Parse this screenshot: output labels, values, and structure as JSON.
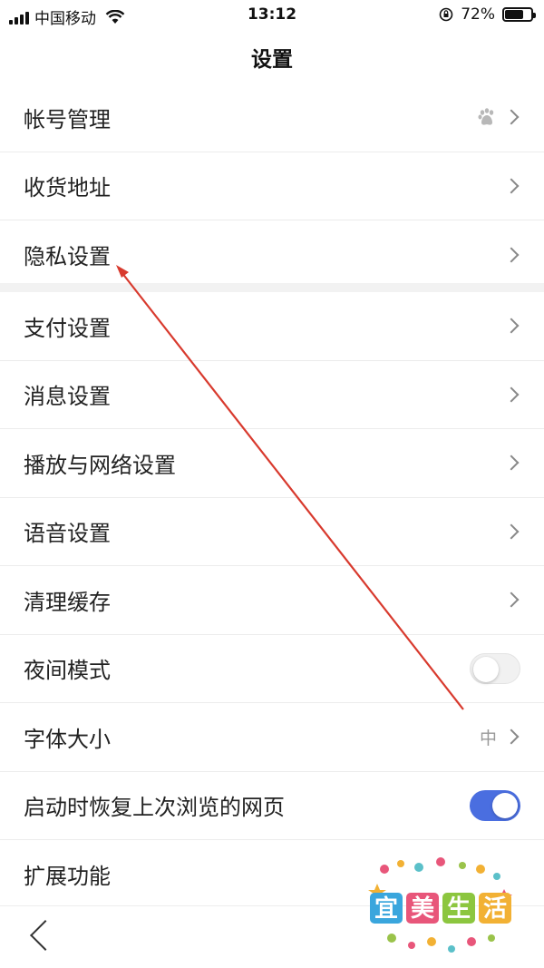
{
  "status_bar": {
    "carrier": "中国移动",
    "time": "13:12",
    "battery_percent": "72%",
    "battery_level": 0.72
  },
  "header": {
    "title": "设置"
  },
  "sections": [
    {
      "items": [
        {
          "label": "帐号管理",
          "accessory": "chevron",
          "icon": "baidu-paw-icon"
        },
        {
          "label": "收货地址",
          "accessory": "chevron"
        },
        {
          "label": "隐私设置",
          "accessory": "chevron"
        }
      ]
    },
    {
      "items": [
        {
          "label": "支付设置",
          "accessory": "chevron"
        },
        {
          "label": "消息设置",
          "accessory": "chevron"
        },
        {
          "label": "播放与网络设置",
          "accessory": "chevron"
        },
        {
          "label": "语音设置",
          "accessory": "chevron"
        },
        {
          "label": "清理缓存",
          "accessory": "chevron"
        },
        {
          "label": "夜间模式",
          "accessory": "toggle",
          "toggle_on": false
        },
        {
          "label": "字体大小",
          "accessory": "chevron",
          "value": "中"
        },
        {
          "label": "启动时恢复上次浏览的网页",
          "accessory": "toggle",
          "toggle_on": true
        },
        {
          "label": "扩展功能",
          "accessory": "none"
        }
      ]
    }
  ],
  "colors": {
    "toggle_on": "#4a6ee0",
    "annotation_arrow": "#d83a2e"
  },
  "watermark": {
    "text": "宜美生活"
  },
  "bottom_bar": {
    "back_icon": "chevron-left-icon"
  }
}
